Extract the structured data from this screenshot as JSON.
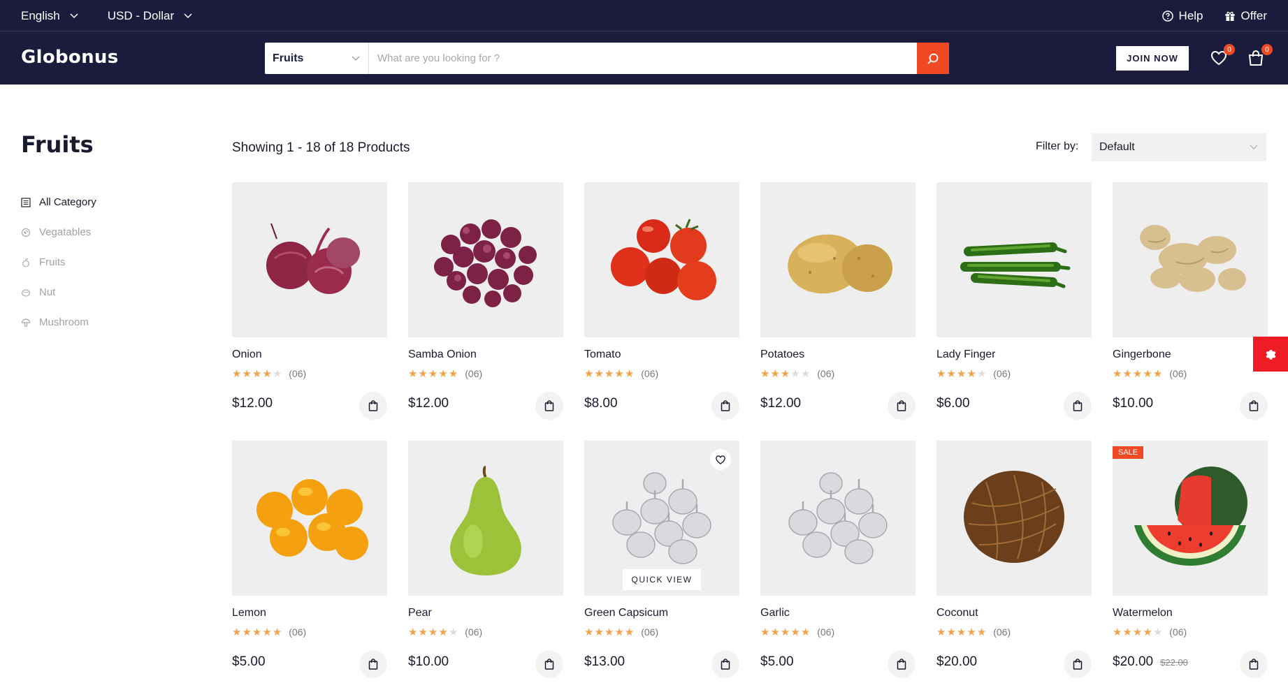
{
  "topbar": {
    "language": "English",
    "currency": "USD - Dollar",
    "help": "Help",
    "offer": "Offer"
  },
  "header": {
    "logo": "Globonus",
    "search_category": "Fruits",
    "search_placeholder": "What are you looking for ?",
    "join_label": "JOIN NOW",
    "wishlist_count": "0",
    "cart_count": "0"
  },
  "sidebar": {
    "title": "Fruits",
    "items": [
      {
        "label": "All Category",
        "icon": "list-icon"
      },
      {
        "label": "Vegatables",
        "icon": "vegetable-icon"
      },
      {
        "label": "Fruits",
        "icon": "fruit-icon"
      },
      {
        "label": "Nut",
        "icon": "nut-icon"
      },
      {
        "label": "Mushroom",
        "icon": "mushroom-icon"
      }
    ]
  },
  "toolbar": {
    "showing": "Showing 1 - 18 of 18 Products",
    "filter_label": "Filter by:",
    "filter_value": "Default"
  },
  "products": [
    {
      "name": "Onion",
      "rating": 4,
      "count": "(06)",
      "price": "$12.00",
      "image": "onion"
    },
    {
      "name": "Samba Onion",
      "rating": 5,
      "count": "(06)",
      "price": "$12.00",
      "image": "samba-onion"
    },
    {
      "name": "Tomato",
      "rating": 5,
      "count": "(06)",
      "price": "$8.00",
      "image": "tomato"
    },
    {
      "name": "Potatoes",
      "rating": 3,
      "count": "(06)",
      "price": "$12.00",
      "image": "potato"
    },
    {
      "name": "Lady Finger",
      "rating": 4,
      "count": "(06)",
      "price": "$6.00",
      "image": "okra"
    },
    {
      "name": "Gingerbone",
      "rating": 5,
      "count": "(06)",
      "price": "$10.00",
      "image": "ginger"
    },
    {
      "name": "Lemon",
      "rating": 5,
      "count": "(06)",
      "price": "$5.00",
      "image": "lemon"
    },
    {
      "name": "Pear",
      "rating": 4,
      "count": "(06)",
      "price": "$10.00",
      "image": "pear"
    },
    {
      "name": "Green Capsicum",
      "rating": 5,
      "count": "(06)",
      "price": "$13.00",
      "image": "garlic",
      "quick_view": "QUICK VIEW",
      "wish": true
    },
    {
      "name": "Garlic",
      "rating": 5,
      "count": "(06)",
      "price": "$5.00",
      "image": "garlic"
    },
    {
      "name": "Coconut",
      "rating": 5,
      "count": "(06)",
      "price": "$20.00",
      "image": "coconut"
    },
    {
      "name": "Watermelon",
      "rating": 4,
      "count": "(06)",
      "price": "$20.00",
      "old_price": "$22.00",
      "sale": "SALE",
      "image": "watermelon"
    }
  ],
  "colors": {
    "navy": "#1b1c3d",
    "accent": "#f04a24",
    "star": "#f2a24b",
    "settings": "#ee1c25"
  }
}
